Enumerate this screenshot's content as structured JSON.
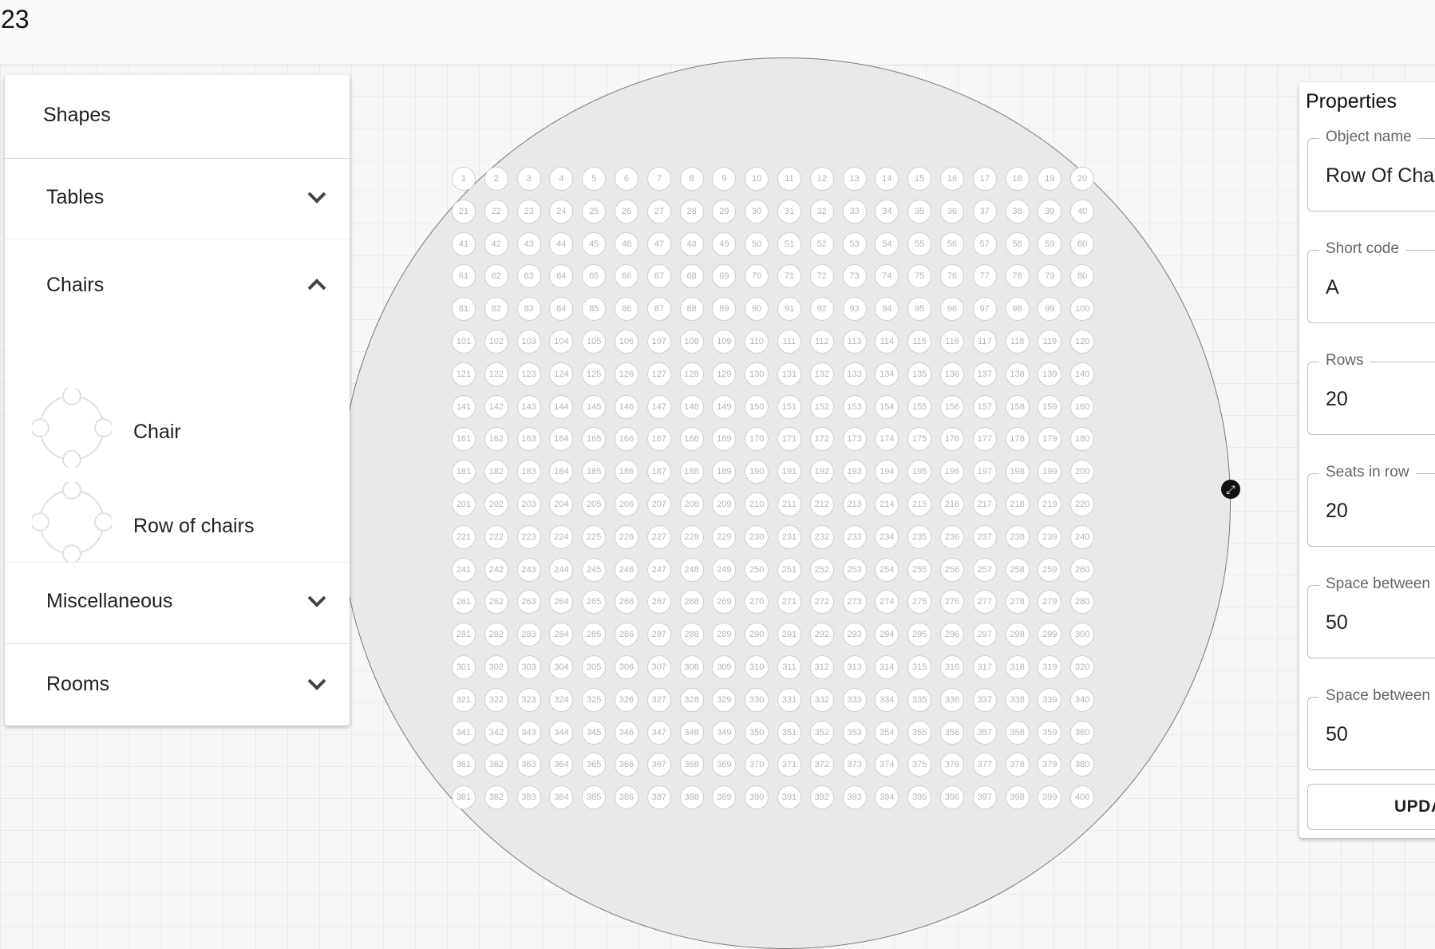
{
  "header": {
    "count": "23"
  },
  "sidebar": {
    "sections": [
      {
        "title": "Shapes"
      },
      {
        "title": "Tables",
        "expanded": false
      },
      {
        "title": "Chairs",
        "expanded": true,
        "items": [
          {
            "label": "Chair"
          },
          {
            "label": "Row of chairs"
          }
        ]
      },
      {
        "title": "Miscellaneous",
        "expanded": false
      },
      {
        "title": "Rooms",
        "expanded": false
      }
    ]
  },
  "canvas": {
    "rows": 20,
    "seats_per_row": 20
  },
  "properties": {
    "title": "Properties",
    "fields": [
      {
        "label": "Object name",
        "value": "Row Of Chairs"
      },
      {
        "label": "Short code",
        "value": "A"
      },
      {
        "label": "Rows",
        "value": "20"
      },
      {
        "label": "Seats in row",
        "value": "20"
      },
      {
        "label": "Space between",
        "value": "50"
      },
      {
        "label": "Space between",
        "value": "50"
      }
    ],
    "update_label": "UPDATE"
  }
}
